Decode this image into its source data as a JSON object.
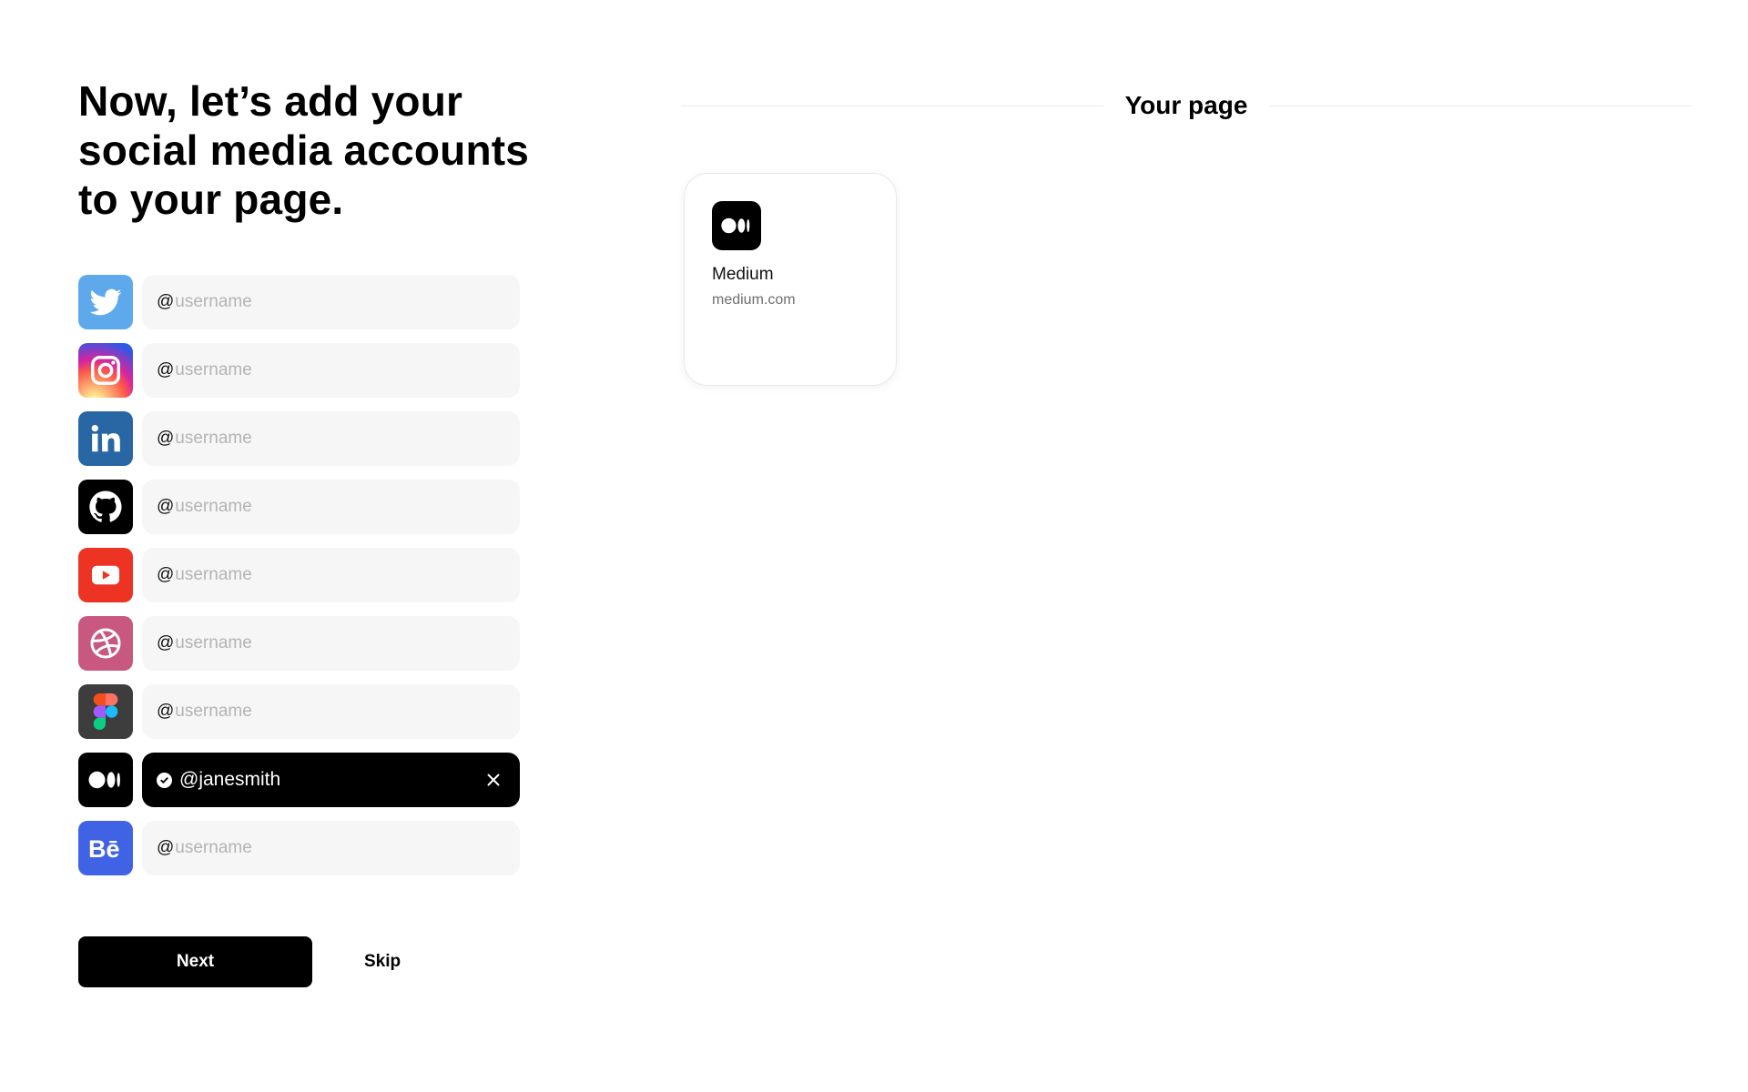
{
  "heading": "Now, let’s add your social media accounts to your page.",
  "accounts": [
    {
      "network": "twitter",
      "icon": "twitter-icon",
      "color": "#5da9ec",
      "prefix": "@",
      "placeholder": "username",
      "value": ""
    },
    {
      "network": "instagram",
      "icon": "instagram-icon",
      "color": "#d62e7f",
      "prefix": "@",
      "placeholder": "username",
      "value": ""
    },
    {
      "network": "linkedin",
      "icon": "linkedin-icon",
      "color": "#2867a3",
      "prefix": "@",
      "placeholder": "username",
      "value": ""
    },
    {
      "network": "github",
      "icon": "github-icon",
      "color": "#000000",
      "prefix": "@",
      "placeholder": "username",
      "value": ""
    },
    {
      "network": "youtube",
      "icon": "youtube-icon",
      "color": "#ec3324",
      "prefix": "@",
      "placeholder": "username",
      "value": ""
    },
    {
      "network": "dribbble",
      "icon": "dribbble-icon",
      "color": "#c8587f",
      "prefix": "@",
      "placeholder": "username",
      "value": ""
    },
    {
      "network": "figma",
      "icon": "figma-icon",
      "color": "#3d3d3d",
      "prefix": "@",
      "placeholder": "username",
      "value": ""
    },
    {
      "network": "medium",
      "icon": "medium-icon",
      "color": "#000000",
      "value": "@janesmith",
      "verified": true
    },
    {
      "network": "behance",
      "icon": "behance-icon",
      "color": "#3f63e4",
      "prefix": "@",
      "placeholder": "username",
      "value": ""
    }
  ],
  "actions": {
    "next_label": "Next",
    "skip_label": "Skip"
  },
  "preview": {
    "title": "Your page",
    "card": {
      "icon": "medium-icon",
      "title": "Medium",
      "url": "medium.com"
    }
  }
}
